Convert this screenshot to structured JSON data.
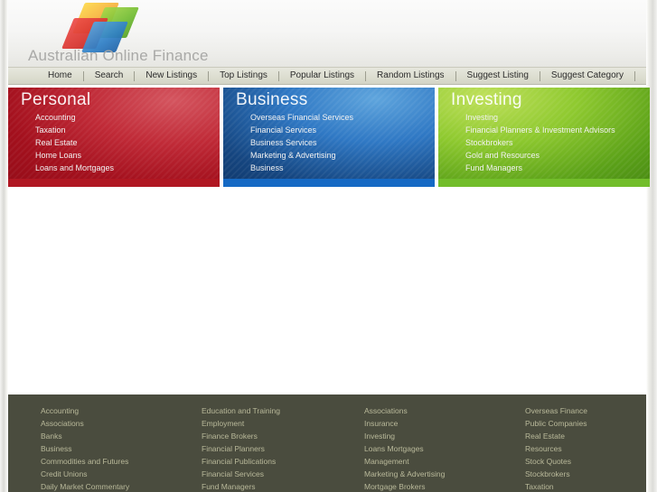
{
  "site": {
    "title": "Australian Online Finance",
    "logo_icon": "four-tiles-logo",
    "logo_colors": [
      "#f5a93c",
      "#73bd33",
      "#d9352f",
      "#2f7fc6"
    ]
  },
  "nav": {
    "items": [
      {
        "label": "Home"
      },
      {
        "label": "Search"
      },
      {
        "label": "New Listings"
      },
      {
        "label": "Top Listings"
      },
      {
        "label": "Popular Listings"
      },
      {
        "label": "Random Listings"
      },
      {
        "label": "Suggest Listing"
      },
      {
        "label": "Suggest Category"
      }
    ]
  },
  "panels": [
    {
      "key": "personal",
      "title": "Personal",
      "accent": "#b01722",
      "links": [
        "Accounting",
        "Taxation",
        "Real Estate",
        "Home Loans",
        "Loans and Mortgages"
      ]
    },
    {
      "key": "business",
      "title": "Business",
      "accent": "#1569c4",
      "links": [
        "Overseas Financial Services",
        "Financial Services",
        "Business Services",
        "Marketing & Advertising",
        "Business"
      ]
    },
    {
      "key": "investing",
      "title": "Investing",
      "accent": "#72bd2a",
      "links": [
        "Investing",
        "Financial Planners & Investment Advisors",
        "Stockbrokers",
        "Gold and Resources",
        "Fund Managers"
      ]
    }
  ],
  "footer": {
    "background": "#4a4c3e",
    "columns": [
      [
        "Accounting",
        "Associations",
        "Banks",
        "Business",
        "Commodities and Futures",
        "Credit Unions",
        "Daily Market Commentary"
      ],
      [
        "Education and Training",
        "Employment",
        "Finance Brokers",
        "Financial Planners",
        "Financial Publications",
        "Financial Services",
        "Fund Managers"
      ],
      [
        "Associations",
        "Insurance",
        "Investing",
        "Loans Mortgages",
        "Management",
        "Marketing & Advertising",
        "Mortgage Brokers"
      ],
      [
        "Overseas Finance",
        "Public Companies",
        "Real Estate",
        "Resources",
        "Stock Quotes",
        "Stockbrokers",
        "Taxation"
      ]
    ]
  }
}
